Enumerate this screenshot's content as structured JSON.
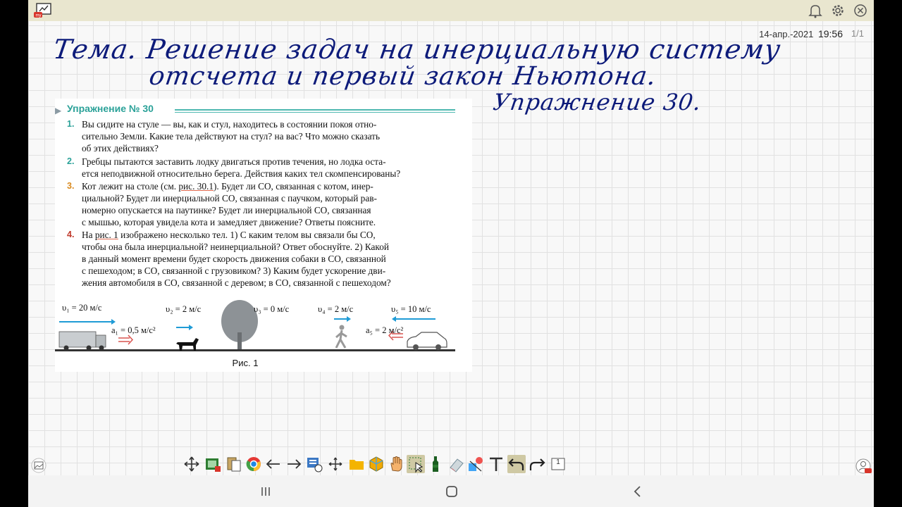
{
  "topbar": {
    "app_icon": "whiteboard-app-icon",
    "right_icons": [
      "bell-icon",
      "gear-icon",
      "close-icon"
    ]
  },
  "status": {
    "date": "14-апр.-2021",
    "time": "19:56",
    "page": "1/1"
  },
  "handwriting": {
    "topic_line1": "Тема. Решение задач на инерциальную систему",
    "topic_line2": "отсчета и первый закон Ньютона.",
    "exercise": "Упражнение 30."
  },
  "excerpt": {
    "title": "Упражнение № 30",
    "tasks": [
      {
        "num": "1.",
        "lines": [
          "Вы сидите на стуле — вы, как и стул, находитесь в состоянии покоя отно-",
          "сительно Земли. Какие тела действуют на стул? на вас? Что можно сказать",
          "об этих действиях?"
        ]
      },
      {
        "num": "2.",
        "lines": [
          "Гребцы пытаются заставить лодку двигаться против течения, но лодка оста-",
          "ется неподвижной относительно берега. Действия каких тел скомпенсированы?"
        ]
      },
      {
        "num": "3.",
        "line1_pre": "Кот лежит на столе (см. ",
        "line1_link": "рис. 30.1",
        "line1_post": "). Будет ли СО, связанная с котом, инер-",
        "lines": [
          "циальной? Будет ли инерциальной СО, связанная с паучком, который рав-",
          "номерно опускается на паутинке? Будет ли инерциальной СО, связанная",
          "с мышью, которая увидела кота и замедляет движение? Ответы поясните."
        ]
      },
      {
        "num": "4.",
        "line1_pre": "На ",
        "line1_link": "рис. 1",
        "line1_post": " изображено несколько тел. 1) С каким телом вы связали бы СО,",
        "lines": [
          "чтобы она была инерциальной? неинерциальной? Ответ обоснуйте. 2) Какой",
          "в данный момент времени будет скорость движения собаки в СО, связанной",
          "с пешеходом; в СО, связанной с грузовиком? 3) Каким будет ускорение дви-",
          "жения автомобиля в СО, связанной с деревом; в СО, связанной с пешеходом?"
        ]
      }
    ],
    "figure": {
      "v1": "υ₁ = 20 м/с",
      "a1": "a₁ = 0,5 м/с²",
      "v2": "υ₂ = 2 м/с",
      "v3": "υ₃ = 0 м/с",
      "v4": "υ₄ = 2 м/с",
      "a5": "a₅ = 2 м/с²",
      "v5": "υ₅ = 10 м/с",
      "caption": "Рис. 1"
    }
  },
  "toolbar": {
    "tools": [
      "move-icon",
      "image-insert-icon",
      "clipboard-icon",
      "browser-icon",
      "arrow-left-icon",
      "arrow-right-icon",
      "screenshot-icon",
      "pan-icon",
      "folder-icon",
      "3d-box-icon",
      "hand-icon",
      "select-icon",
      "marker-icon",
      "eraser-icon",
      "shapes-icon",
      "text-icon",
      "undo-icon",
      "redo-icon",
      "page-icon"
    ],
    "page_number": "1"
  },
  "colors": {
    "accent_teal": "#2aa198",
    "ink_blue": "#0d1b7a",
    "topbar": "#e9e6cf"
  }
}
